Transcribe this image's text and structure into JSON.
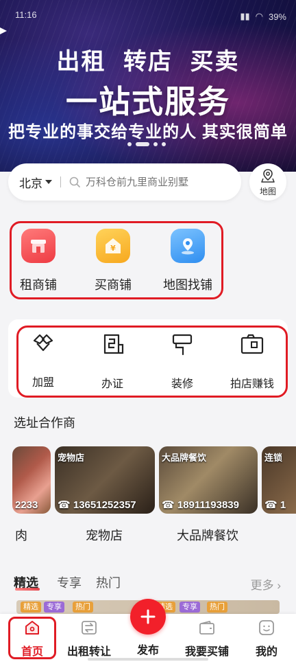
{
  "status_bar": {
    "time": "11:16",
    "battery": "39%"
  },
  "banner": {
    "line1": "出租  转店  买卖",
    "line2": "一站式服务",
    "line3": "把专业的事交给专业的人  其实很简单"
  },
  "search": {
    "city": "北京",
    "placeholder": "万科仓前九里商业别墅",
    "map_label": "地图"
  },
  "categories": [
    {
      "label": "租商铺",
      "icon": "shop-icon",
      "color": "#f0484d"
    },
    {
      "label": "买商铺",
      "icon": "house-yuan-icon",
      "color": "#fbb62c"
    },
    {
      "label": "地图找铺",
      "icon": "map-pin-icon",
      "color": "#3d9bf5"
    }
  ],
  "services": [
    {
      "label": "加盟",
      "icon": "handshake-icon"
    },
    {
      "label": "办证",
      "icon": "certificate-icon"
    },
    {
      "label": "装修",
      "icon": "paint-roller-icon"
    },
    {
      "label": "拍店赚钱",
      "icon": "camera-icon"
    }
  ],
  "partners": {
    "title": "选址合作商",
    "cards": [
      {
        "caption": "",
        "phone": "2233",
        "name": "肉"
      },
      {
        "caption": "宠物店",
        "phone": "13651252357",
        "name": "宠物店"
      },
      {
        "caption": "大品牌餐饮",
        "phone": "18911193839",
        "name": "大品牌餐饮"
      },
      {
        "caption": "连锁",
        "phone": "1",
        "name": ""
      }
    ]
  },
  "feed_tabs": {
    "tabs": [
      "精选",
      "专享",
      "热门"
    ],
    "more": "更多"
  },
  "feed_tags": [
    "精选",
    "专享",
    "热门",
    "精选",
    "专享",
    "热门"
  ],
  "bottom_nav": {
    "items": [
      "首页",
      "出租转让",
      "发布",
      "我要买铺",
      "我的"
    ]
  },
  "colors": {
    "accent": "#e01b24",
    "fab": "#f2202a"
  }
}
